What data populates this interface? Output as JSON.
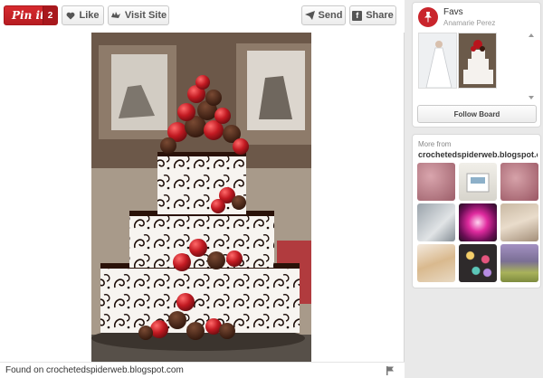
{
  "toolbar": {
    "pin_label": "Pin it",
    "pin_count": "2",
    "like_label": "Like",
    "visit_label": "Visit Site",
    "send_label": "Send",
    "share_label": "Share",
    "share_icon_glyph": "f"
  },
  "footer": {
    "found_on": "Found on crochetedspiderweb.blogspot.com"
  },
  "board": {
    "title": "Favs",
    "owner": "Anamarie Perez",
    "follow_label": "Follow Board"
  },
  "more": {
    "label": "More from",
    "site": "crochetedspiderweb.blogspot.com"
  },
  "colors": {
    "pinterest_red": "#cb2027",
    "strawberry_red": "#b8141c",
    "chocolate": "#3a1a10",
    "frosting": "#f5f2ee"
  },
  "icons": [
    "heart-icon",
    "bird-icon",
    "paper-plane-icon",
    "facebook-icon",
    "flag-icon",
    "pushpin-icon"
  ]
}
